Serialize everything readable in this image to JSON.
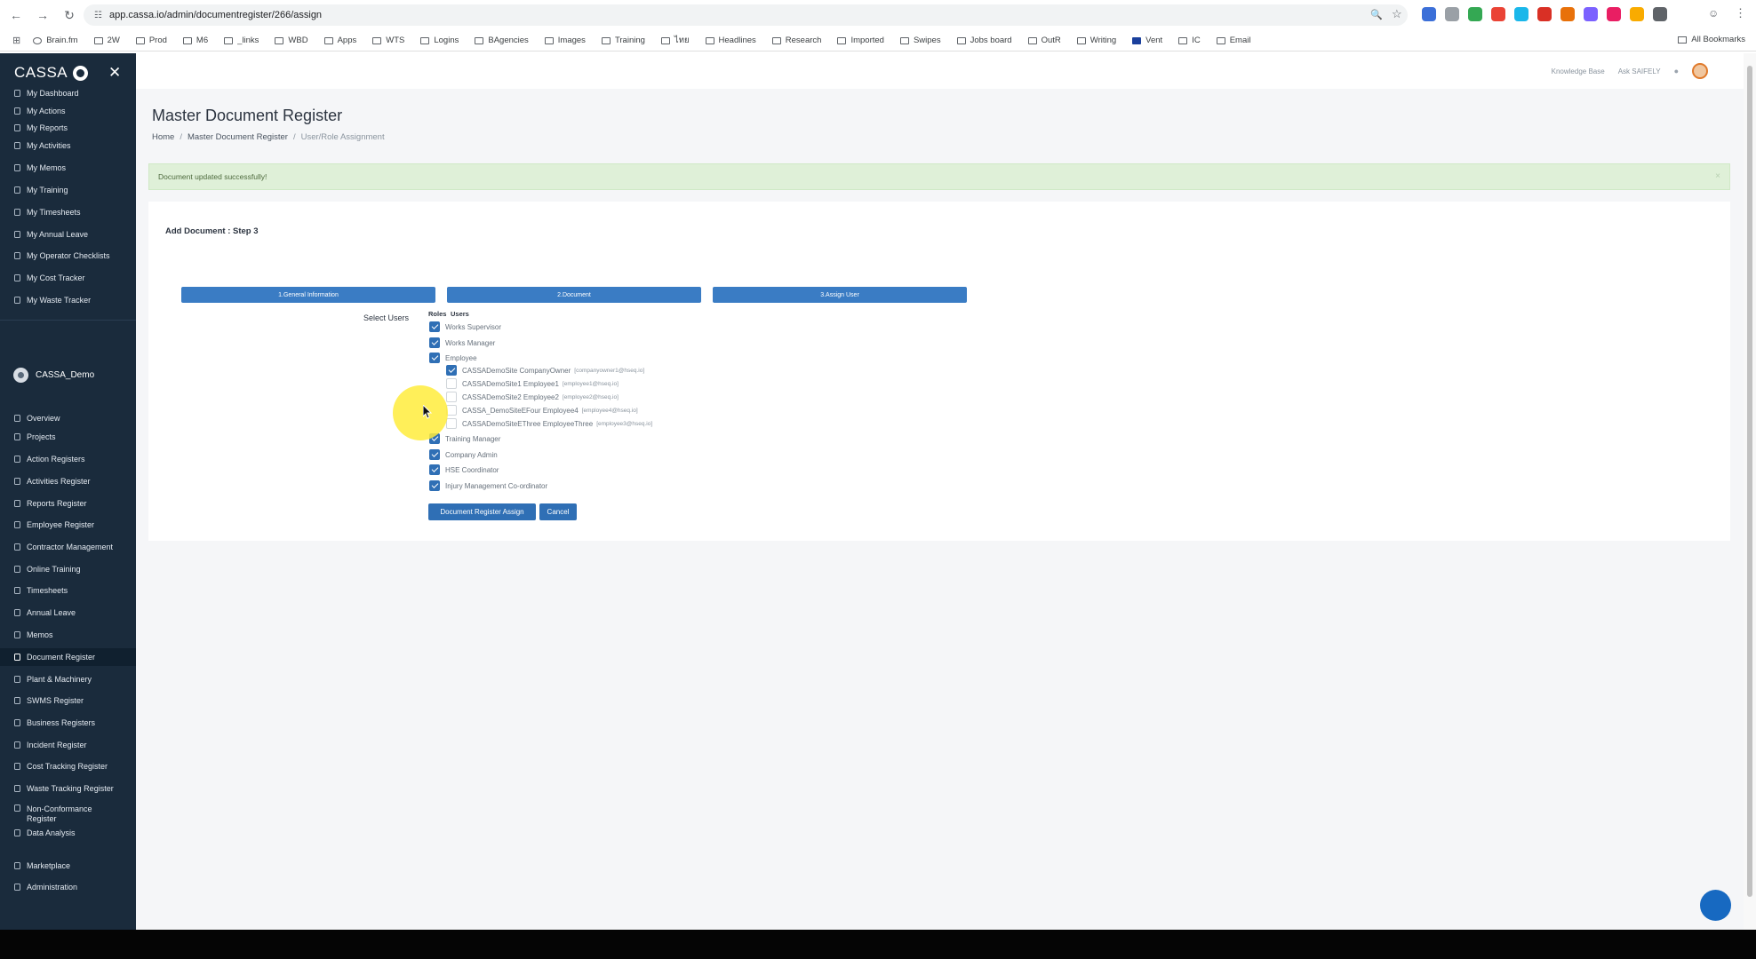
{
  "browser": {
    "url": "app.cassa.io/admin/documentregister/266/assign",
    "bookmarks": [
      "Brain.fm",
      "2W",
      "Prod",
      "M6",
      "_links",
      "WBD",
      "Apps",
      "WTS",
      "Logins",
      "BAgencies",
      "Images",
      "Training",
      "ไทย",
      "Headlines",
      "Research",
      "Imported",
      "Swipes",
      "Jobs board",
      "OutR",
      "Writing",
      "Vent",
      "IC",
      "Email"
    ],
    "all_bookmarks": "All Bookmarks"
  },
  "sidebar": {
    "brand": "CASSA",
    "personal_items": [
      "My Dashboard",
      "My Actions",
      "My Reports",
      "My Activities",
      "My Memos",
      "My Training",
      "My Timesheets",
      "My Annual Leave",
      "My Operator Checklists",
      "My Cost Tracker",
      "My Waste Tracker"
    ],
    "org_name": "CASSA_Demo",
    "org_items": [
      "Overview",
      "Projects",
      "Action Registers",
      "Activities Register",
      "Reports Register",
      "Employee Register",
      "Contractor Management",
      "Online Training",
      "Timesheets",
      "Annual Leave",
      "Memos",
      "Document Register",
      "Plant & Machinery",
      "SWMS Register",
      "Business Registers",
      "Incident Register",
      "Cost Tracking Register",
      "Waste Tracking Register",
      "Non-Conformance Register",
      "Data Analysis",
      "Marketplace",
      "Administration"
    ],
    "active_item": "Document Register"
  },
  "topbar": {
    "knowledge_base": "Knowledge Base",
    "ask_saifely": "Ask SAIFELY"
  },
  "page": {
    "title": "Master Document Register",
    "breadcrumb": [
      "Home",
      "Master Document Register",
      "User/Role Assignment"
    ],
    "alert": "Document updated successfully!",
    "alert_close": "×"
  },
  "form": {
    "title": "Add Document : Step 3",
    "steps": [
      "1.General Information",
      "2.Document",
      "3.Assign User"
    ],
    "select_users_label": "Select Users",
    "roles_header": "Roles",
    "users_header": "Users",
    "roles": [
      {
        "name": "Works Supervisor",
        "checked": true
      },
      {
        "name": "Works Manager",
        "checked": true
      },
      {
        "name": "Employee",
        "checked": true
      }
    ],
    "employee_users": [
      {
        "name": "CASSADemoSite CompanyOwner",
        "email": "[companyowner1@hseq.io]",
        "checked": true
      },
      {
        "name": "CASSADemoSite1 Employee1",
        "email": "[employee1@hseq.io]",
        "checked": false
      },
      {
        "name": "CASSADemoSite2 Employee2",
        "email": "[employee2@hseq.io]",
        "checked": false
      },
      {
        "name": "CASSA_DemoSiteEFour Employee4",
        "email": "[employee4@hseq.io]",
        "checked": false
      },
      {
        "name": "CASSADemoSiteEThree EmployeeThree",
        "email": "[employee3@hseq.io]",
        "checked": false
      }
    ],
    "more_roles": [
      {
        "name": "Training Manager",
        "checked": true
      },
      {
        "name": "Company Admin",
        "checked": true
      },
      {
        "name": "HSE Coordinator",
        "checked": true
      },
      {
        "name": "Injury Management Co-ordinator",
        "checked": true
      }
    ],
    "assign_button": "Document Register Assign",
    "cancel_button": "Cancel"
  },
  "colors": {
    "sidebar_bg": "#1a2b3c",
    "accent": "#2f6fb5",
    "alert_bg": "#dff0d8"
  },
  "icons": [
    "back-icon",
    "forward-icon",
    "reload-icon",
    "site-info-icon",
    "zoom-icon",
    "star-icon",
    "apps-grid-icon",
    "close-icon",
    "bell-icon",
    "cursor-highlight",
    "chat-bubble-icon"
  ]
}
